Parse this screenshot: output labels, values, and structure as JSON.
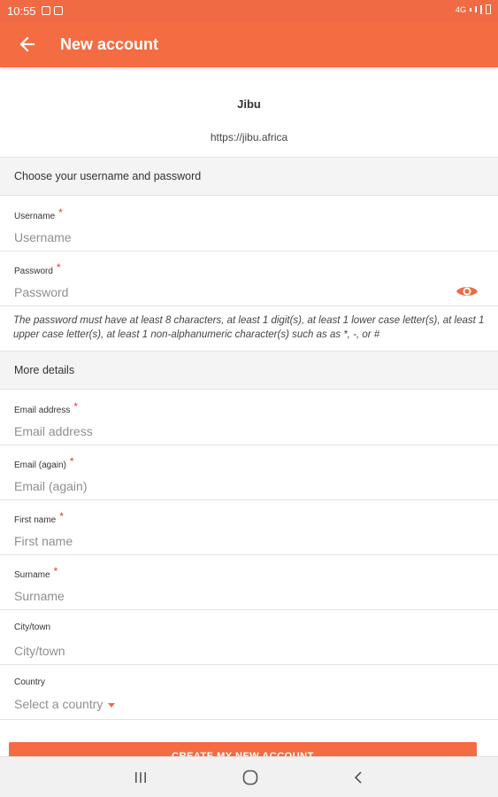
{
  "status_bar": {
    "time": "10:55",
    "network": "4G"
  },
  "app_bar": {
    "title": "New account"
  },
  "site": {
    "name": "Jibu",
    "url": "https://jibu.africa"
  },
  "sections": {
    "credentials": "Choose your username and password",
    "details": "More details"
  },
  "fields": {
    "username": {
      "label": "Username",
      "placeholder": "Username",
      "value": "",
      "required": "*"
    },
    "password": {
      "label": "Password",
      "placeholder": "Password",
      "value": "",
      "required": "*"
    },
    "email": {
      "label": "Email address",
      "placeholder": "Email address",
      "value": "",
      "required": "*"
    },
    "email_again": {
      "label": "Email (again)",
      "placeholder": "Email (again)",
      "value": "",
      "required": "*"
    },
    "first_name": {
      "label": "First name",
      "placeholder": "First name",
      "value": "",
      "required": "*"
    },
    "surname": {
      "label": "Surname",
      "placeholder": "Surname",
      "value": "",
      "required": "*"
    },
    "city": {
      "label": "City/town",
      "placeholder": "City/town",
      "value": ""
    },
    "country": {
      "label": "Country",
      "selected": "Select a country"
    }
  },
  "password_hint": "The password must have at least 8 characters, at least 1 digit(s), at least 1 lower case letter(s), at least 1 upper case letter(s), at least 1 non-alphanumeric character(s) such as as *, -, or #",
  "create_button": "CREATE MY NEW ACCOUNT",
  "icons": {
    "back": "arrow-left-icon",
    "eye": "eye-icon",
    "nav_recents": "recents-icon",
    "nav_home": "home-icon",
    "nav_back": "chevron-left-icon"
  },
  "colors": {
    "primary": "#f46c42",
    "required": "#e53935"
  }
}
